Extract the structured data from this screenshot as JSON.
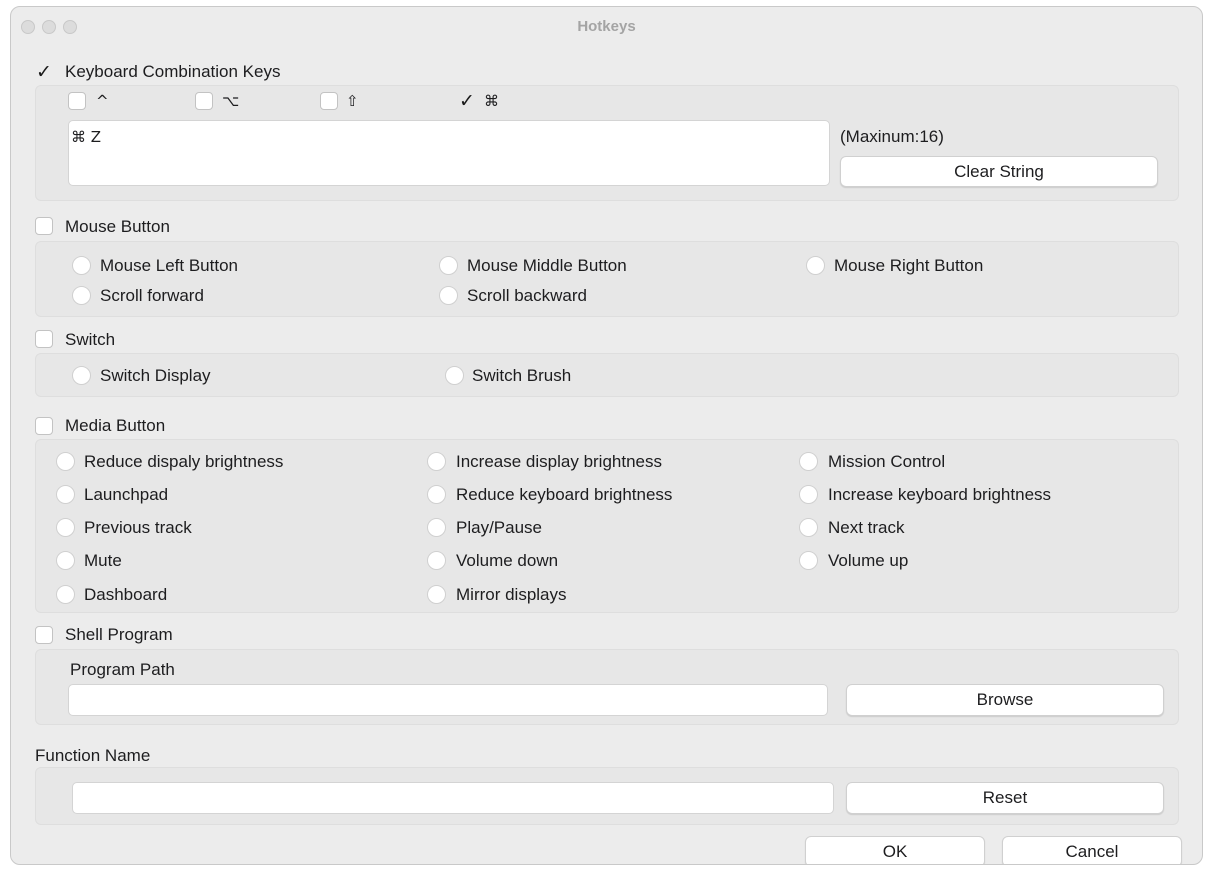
{
  "window": {
    "title": "Hotkeys"
  },
  "keyboard": {
    "label": "Keyboard Combination Keys",
    "enabled": true,
    "modifiers": [
      {
        "glyph": "^",
        "name": "control",
        "checked": false
      },
      {
        "glyph": "⌥",
        "name": "option",
        "checked": false
      },
      {
        "glyph": "⇧",
        "name": "shift",
        "checked": false
      },
      {
        "glyph": "⌘",
        "name": "command",
        "checked": true
      }
    ],
    "key_string": "⌘ Z",
    "max_note": "(Maxinum:16)",
    "clear_label": "Clear String"
  },
  "mouse": {
    "label": "Mouse Button",
    "enabled": false,
    "options": [
      "Mouse Left Button",
      "Mouse Middle Button",
      "Mouse Right Button",
      "Scroll forward",
      "Scroll backward"
    ]
  },
  "switch": {
    "label": "Switch",
    "enabled": false,
    "options": [
      "Switch Display",
      "Switch Brush"
    ]
  },
  "media": {
    "label": "Media Button",
    "enabled": false,
    "options": [
      "Reduce dispaly brightness",
      "Increase display brightness",
      "Mission Control",
      "Launchpad",
      "Reduce keyboard brightness",
      "Increase keyboard brightness",
      "Previous track",
      "Play/Pause",
      "Next track",
      "Mute",
      "Volume down",
      "Volume up",
      "Dashboard",
      "Mirror displays"
    ]
  },
  "shell": {
    "label": "Shell Program",
    "enabled": false,
    "path_label": "Program Path",
    "path_value": "",
    "browse_label": "Browse"
  },
  "function": {
    "label": "Function Name",
    "value": "",
    "reset_label": "Reset"
  },
  "footer": {
    "ok_label": "OK",
    "cancel_label": "Cancel"
  }
}
